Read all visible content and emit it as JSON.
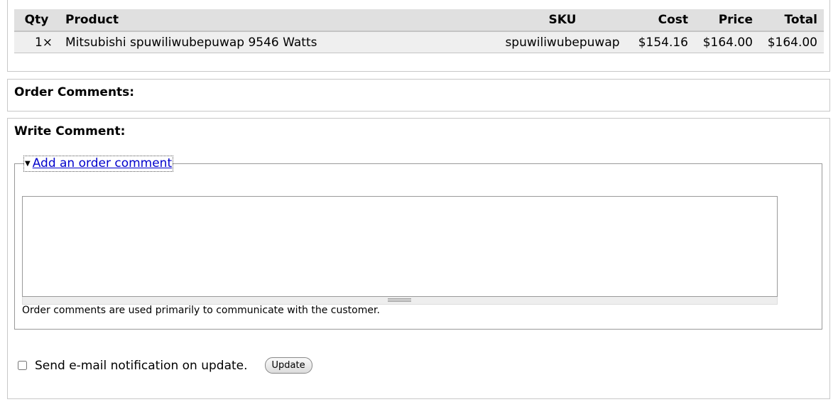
{
  "products_table": {
    "headers": {
      "qty": "Qty",
      "product": "Product",
      "sku": "SKU",
      "cost": "Cost",
      "price": "Price",
      "total": "Total"
    },
    "rows": [
      {
        "qty": "1×",
        "product": "Mitsubishi spuwiliwubepuwap 9546 Watts",
        "sku": "spuwiliwubepuwap",
        "cost": "$154.16",
        "price": "$164.00",
        "total": "$164.00"
      }
    ]
  },
  "order_comments": {
    "title": "Order Comments:"
  },
  "write_comment": {
    "title": "Write Comment:",
    "legend_arrow": "▼",
    "legend_label": "Add an order comment",
    "textarea_value": "",
    "help_text": "Order comments are used primarily to communicate with the customer.",
    "notify_label": "Send e-mail notification on update.",
    "notify_checked": false,
    "update_button": "Update"
  },
  "icons": {
    "legend_toggle": "triangle-down-icon",
    "resize_handle": "grippie-icon"
  }
}
